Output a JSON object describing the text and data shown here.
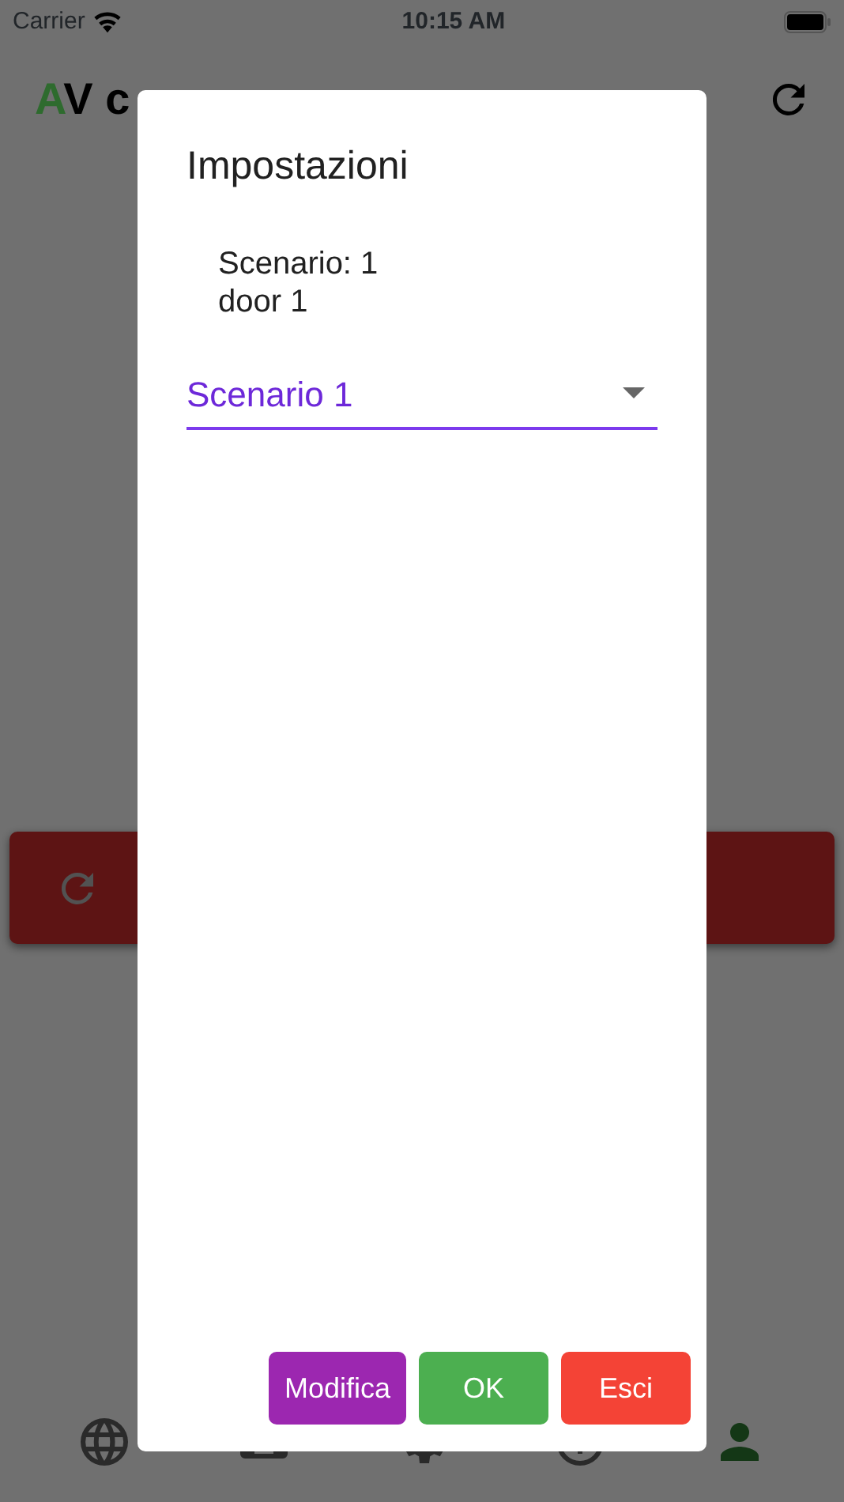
{
  "status_bar": {
    "carrier": "Carrier",
    "time": "10:15 AM"
  },
  "app_bar": {
    "title": [
      {
        "text": "A",
        "color": "#2e6b2e"
      },
      {
        "text": "V c",
        "color": "#000000"
      }
    ]
  },
  "bottom_nav": [
    {
      "selected": false
    },
    {
      "selected": false
    },
    {
      "selected": false
    },
    {
      "selected": false
    },
    {
      "selected": true
    }
  ],
  "dialog": {
    "title": "Impostazioni",
    "info_lines": [
      "Scenario: 1",
      "door 1"
    ],
    "dropdown": {
      "value": "Scenario 1"
    },
    "buttons": [
      {
        "label": "Modifica",
        "color": "#9c27b0"
      },
      {
        "label": "OK",
        "color": "#4caf50"
      },
      {
        "label": "Esci",
        "color": "#f44336"
      }
    ]
  }
}
